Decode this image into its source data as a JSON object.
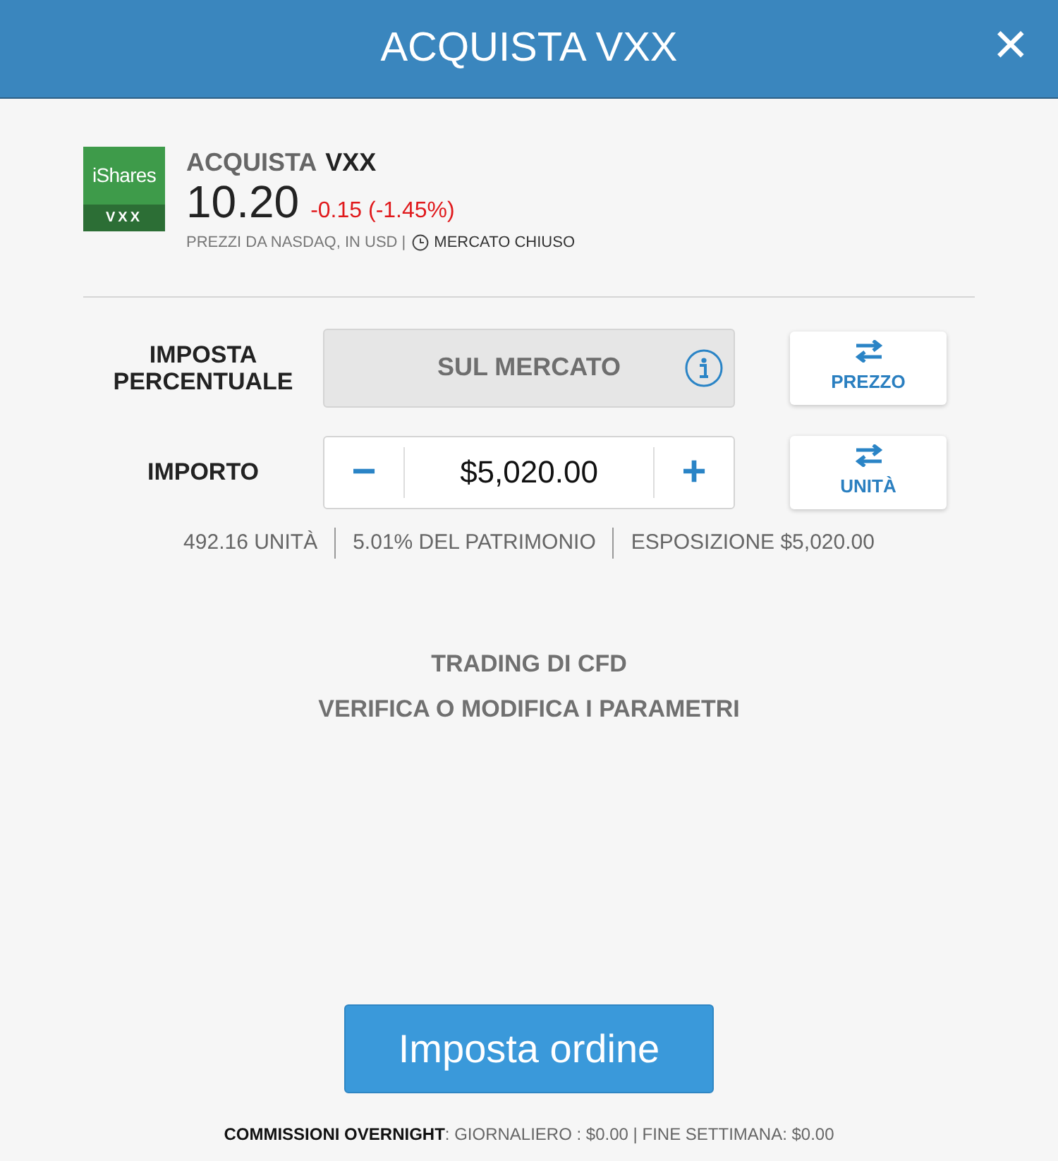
{
  "header": {
    "title": "ACQUISTA VXX",
    "close": "✕"
  },
  "instrument": {
    "logo_brand": "iShares",
    "logo_ticker": "VXX",
    "action": "ACQUISTA",
    "symbol": "VXX",
    "price": "10.20",
    "change": "-0.15 (-1.45%)",
    "source": "PREZZI DA NASDAQ, IN USD |",
    "market_status": "MERCATO CHIUSO"
  },
  "rows": [
    {
      "kind": "rate",
      "label": "IMPOSTA PERCENTUALE",
      "value": "SUL MERCATO",
      "toggle": "PREZZO"
    },
    {
      "kind": "amount",
      "label": "IMPORTO",
      "minus": "−",
      "value": "$5,020.00",
      "plus": "+",
      "toggle": "UNITÀ"
    }
  ],
  "stats": [
    "492.16 UNITÀ",
    "5.01% DEL PATRIMONIO",
    "ESPOSIZIONE $5,020.00"
  ],
  "notice": [
    "TRADING DI CFD",
    "VERIFICA O MODIFICA I PARAMETRI"
  ],
  "submit": "Imposta ordine",
  "fees": "**COMMISSIONI OVERNIGHT**: GIORNALIERO : $0.00 | FINE SETTIMANA: $0.00"
}
